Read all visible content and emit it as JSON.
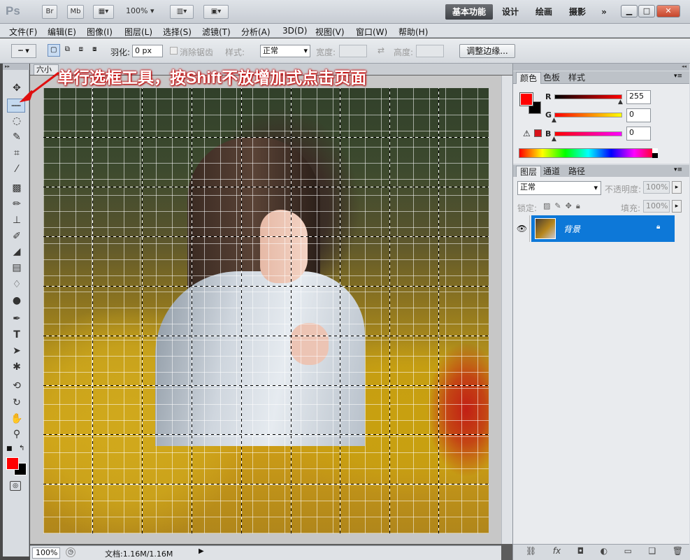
{
  "titlebar": {
    "app_logo": "Ps",
    "bridge_label": "Br",
    "minibridge_label": "Mb",
    "zoom_value": "100%",
    "workspaces": [
      "基本功能",
      "设计",
      "绘画",
      "摄影"
    ],
    "more_label": "»"
  },
  "menu": [
    "文件(F)",
    "编辑(E)",
    "图像(I)",
    "图层(L)",
    "选择(S)",
    "滤镜(T)",
    "分析(A)",
    "3D(D)",
    "视图(V)",
    "窗口(W)",
    "帮助(H)"
  ],
  "options": {
    "feather_label": "羽化:",
    "feather_value": "0 px",
    "antialias_label": "消除锯齿",
    "style_label": "样式:",
    "style_value": "正常",
    "width_label": "宽度:",
    "height_label": "高度:",
    "refine_edge_label": "调整边缘..."
  },
  "document": {
    "tab_label": "六小",
    "zoom": "100%",
    "status_text": "文档:1.16M/1.16M"
  },
  "annotation": "单行选框工具，按Shift不放增加式点击页面",
  "color_panel": {
    "tabs": [
      "颜色",
      "色板",
      "样式"
    ],
    "r_label": "R",
    "r_value": "255",
    "g_label": "G",
    "g_value": "0",
    "b_label": "B",
    "b_value": "0",
    "foreground": "#ff0000",
    "background": "#000000"
  },
  "layers_panel": {
    "tabs": [
      "图层",
      "通道",
      "路径"
    ],
    "blend_mode": "正常",
    "opacity_label": "不透明度:",
    "opacity_value": "100%",
    "lock_label": "锁定:",
    "fill_label": "填充:",
    "fill_value": "100%",
    "layer_name": "背景"
  }
}
